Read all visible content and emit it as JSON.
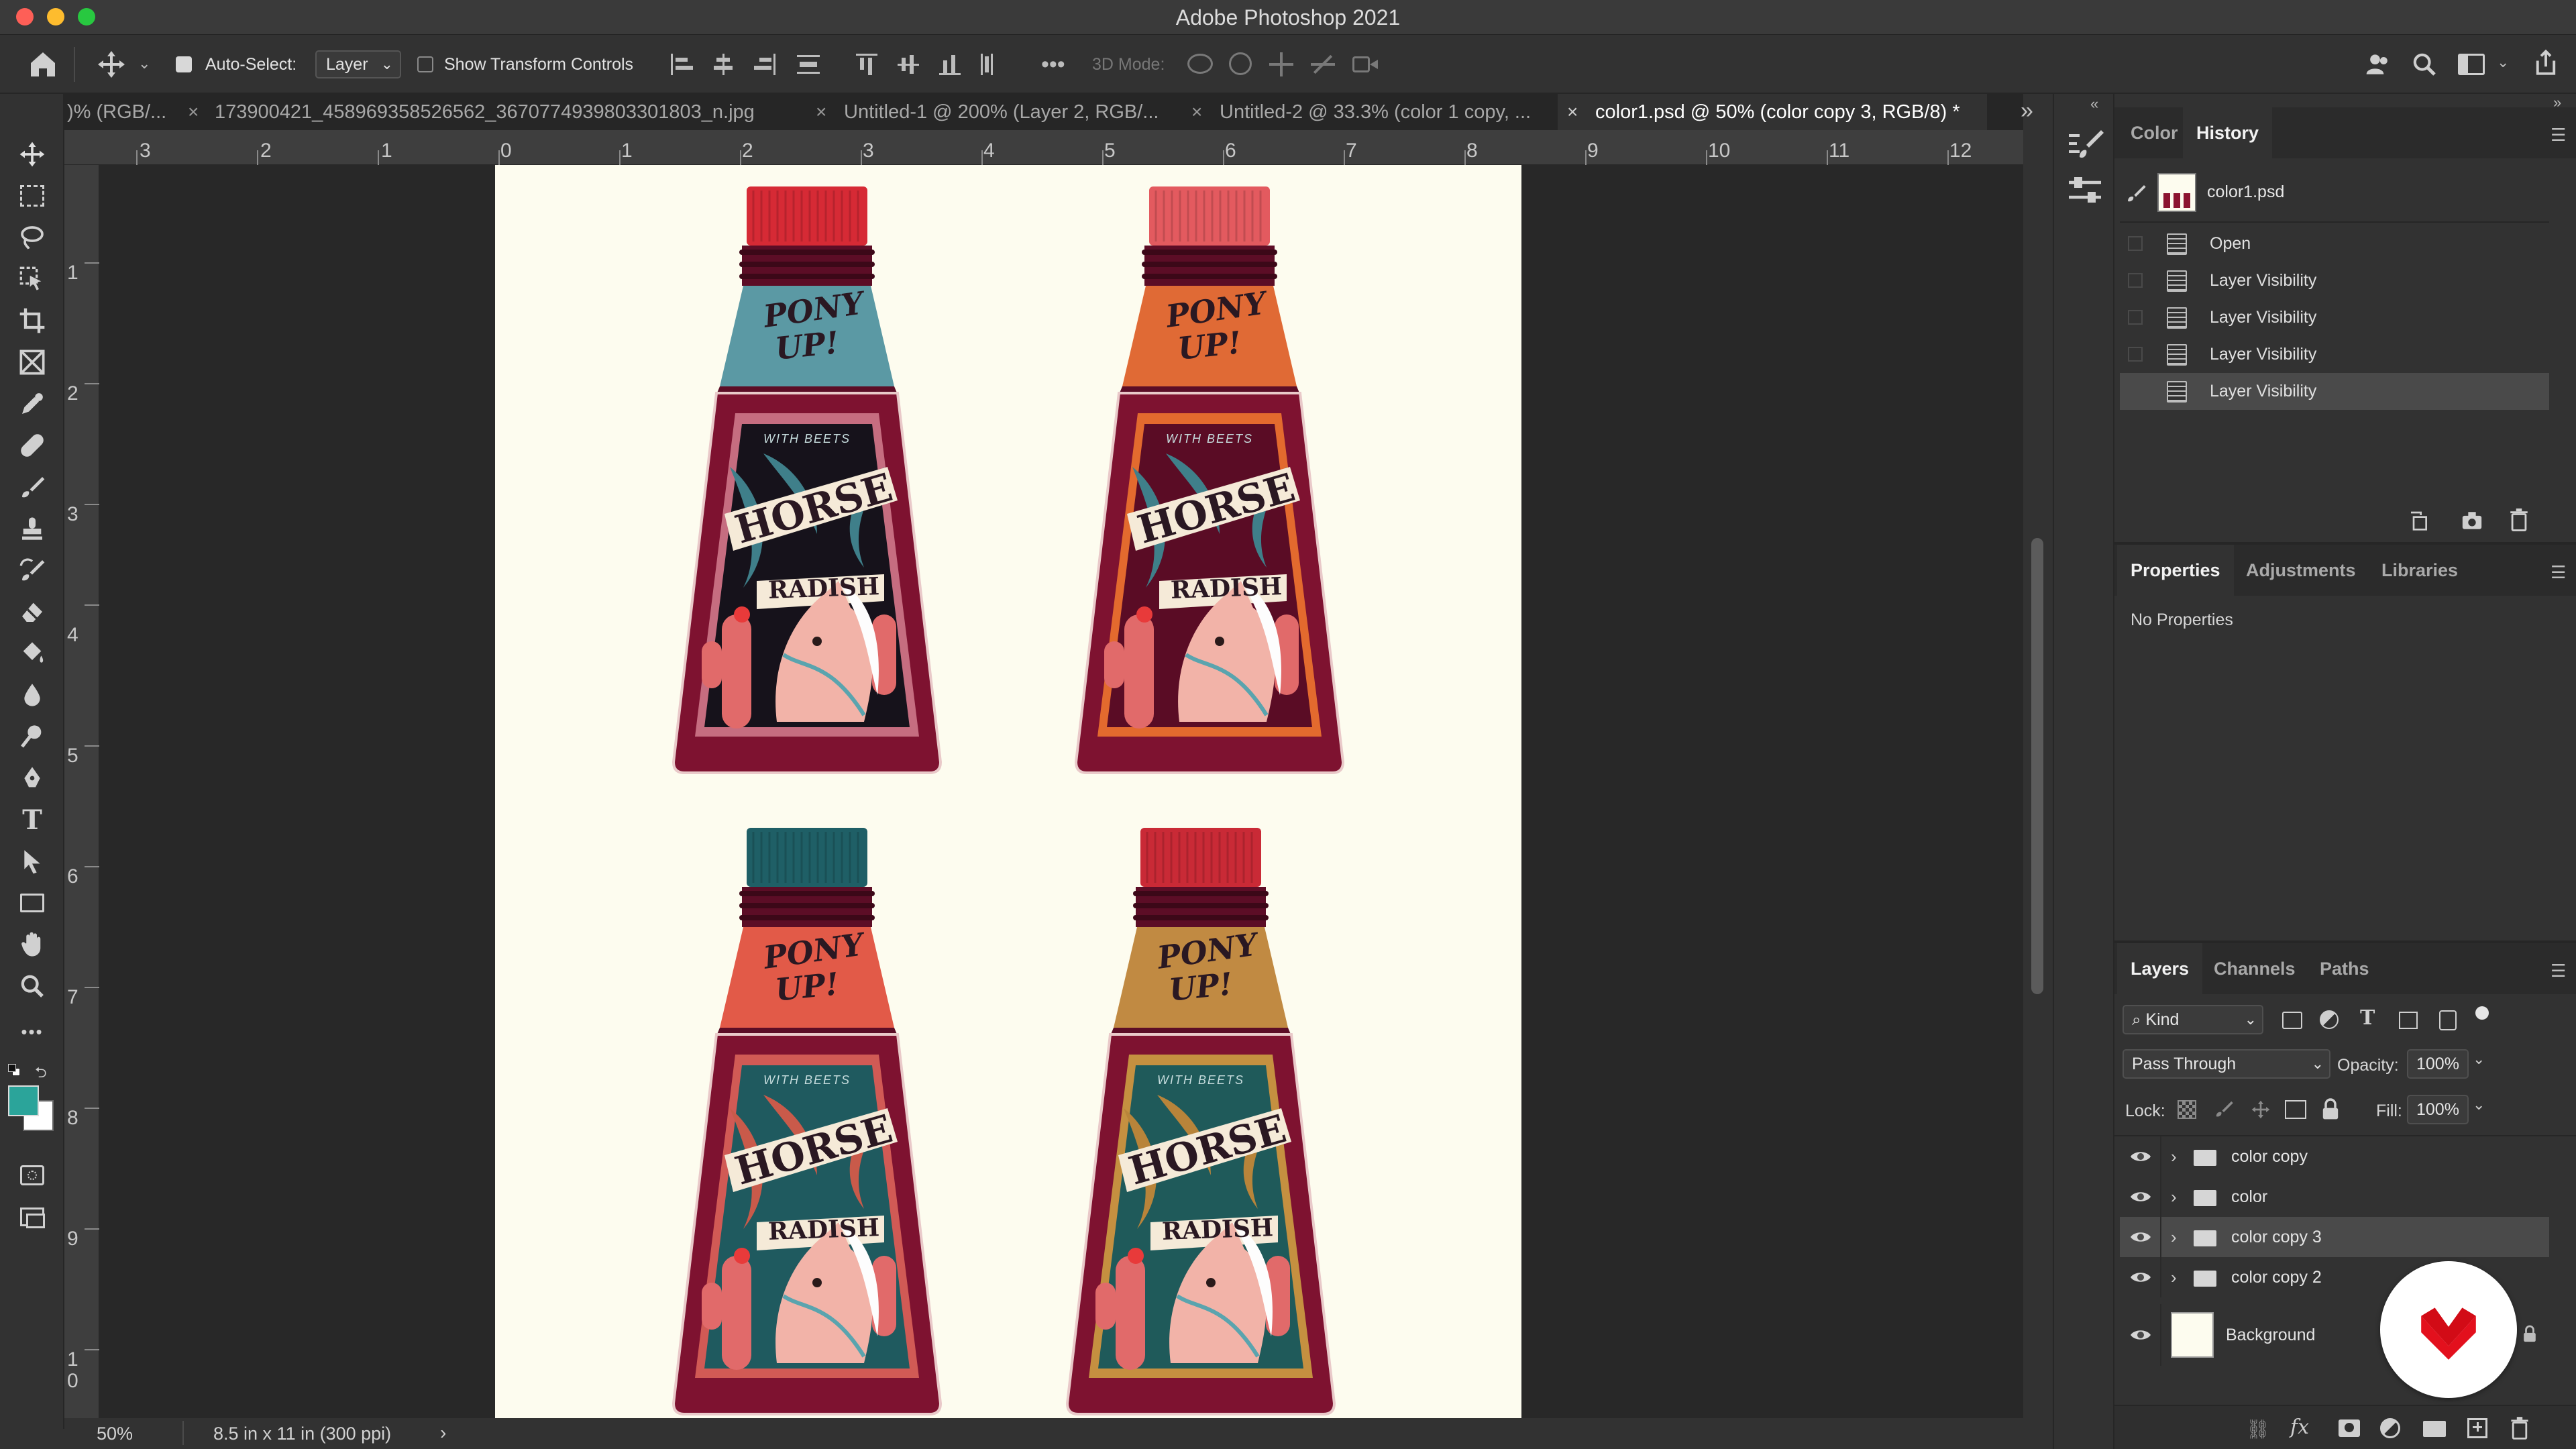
{
  "app": {
    "title": "Adobe Photoshop 2021"
  },
  "options_bar": {
    "auto_select_label": "Auto-Select:",
    "auto_select_value": "Layer",
    "show_transform_label": "Show Transform Controls",
    "three_d_mode_label": "3D Mode:"
  },
  "tabs": [
    {
      "label": ")% (RGB/...",
      "active": false
    },
    {
      "label": "173900421_458969358526562_3670774939803301803_n.jpg",
      "active": false
    },
    {
      "label": "Untitled-1 @ 200% (Layer 2, RGB/...",
      "active": false
    },
    {
      "label": "Untitled-2 @ 33.3% (color 1 copy, ...",
      "active": false
    },
    {
      "label": "color1.psd @ 50% (color copy 3, RGB/8) *",
      "active": true
    }
  ],
  "rulers": {
    "top": [
      "3",
      "2",
      "1",
      "0",
      "1",
      "2",
      "3",
      "4",
      "5",
      "6",
      "7",
      "8",
      "9",
      "10",
      "11",
      "12"
    ],
    "left": [
      "1",
      "2",
      "3",
      "4",
      "5",
      "6",
      "7",
      "8",
      "9",
      "1",
      "0"
    ]
  },
  "status": {
    "zoom": "50%",
    "doc_info": "8.5 in x 11 in (300 ppi)"
  },
  "colors": {
    "foreground": "#2ba49a",
    "background": "#ffffff",
    "accent_red": "#d9363e"
  },
  "labels": {
    "pony": "PONY",
    "up": "UP!",
    "with_beets": "WITH BEETS",
    "horse": "HORSE",
    "radish": "RADISH"
  },
  "bottles": [
    {
      "cap": "#d62a35",
      "neck": "#5b99a4",
      "label_bg": "#16121b",
      "label_accent": "#3f7f8a",
      "border": "#c66d80"
    },
    {
      "cap": "#e35a5f",
      "neck": "#e06a35",
      "label_bg": "#5a0c25",
      "label_accent": "#3f7f8a",
      "border": "#e36a2e"
    },
    {
      "cap": "#1f5f66",
      "neck": "#e25a48",
      "label_bg": "#1f5a5f",
      "label_accent": "#c95a4a",
      "border": "#d15a55"
    },
    {
      "cap": "#c92a36",
      "neck": "#c18a42",
      "label_bg": "#1f5a5a",
      "label_accent": "#b8843a",
      "border": "#c59040"
    }
  ],
  "panels": {
    "top_tabs": [
      "Color",
      "History"
    ],
    "history": {
      "snapshot": "color1.psd",
      "items": [
        "Open",
        "Layer Visibility",
        "Layer Visibility",
        "Layer Visibility",
        "Layer Visibility"
      ]
    },
    "mid_tabs": [
      "Properties",
      "Adjustments",
      "Libraries"
    ],
    "properties_text": "No Properties",
    "layers_tabs": [
      "Layers",
      "Channels",
      "Paths"
    ],
    "layers": {
      "filter_kind": "Kind",
      "blend_mode": "Pass Through",
      "opacity_label": "Opacity:",
      "opacity": "100%",
      "lock_label": "Lock:",
      "fill_label": "Fill:",
      "fill": "100%",
      "items": [
        {
          "name": "color copy",
          "type": "group",
          "selected": false
        },
        {
          "name": "color",
          "type": "group",
          "selected": false
        },
        {
          "name": "color copy 3",
          "type": "group",
          "selected": true
        },
        {
          "name": "color copy 2",
          "type": "group",
          "selected": false
        },
        {
          "name": "Background",
          "type": "image",
          "selected": false
        }
      ]
    }
  }
}
